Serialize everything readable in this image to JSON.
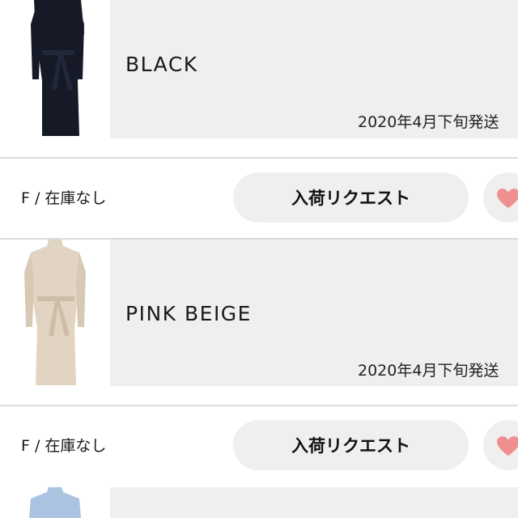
{
  "items": [
    {
      "color_name": "BLACK",
      "shipping": "2020年4月下旬発送",
      "image": "black-knit-dress",
      "size_label": "F / 在庫なし",
      "request_label": "入荷リクエスト",
      "favorite_icon": "heart-icon"
    },
    {
      "color_name": "PINK BEIGE",
      "shipping": "2020年4月下旬発送",
      "image": "pink-beige-knit-dress",
      "size_label": "F / 在庫なし",
      "request_label": "入荷リクエスト",
      "favorite_icon": "heart-icon"
    },
    {
      "image": "light-blue-knit-dress"
    }
  ],
  "colors": {
    "panel_bg": "#efefef",
    "heart": "#f08f8f",
    "divider": "#dcdcdc"
  }
}
